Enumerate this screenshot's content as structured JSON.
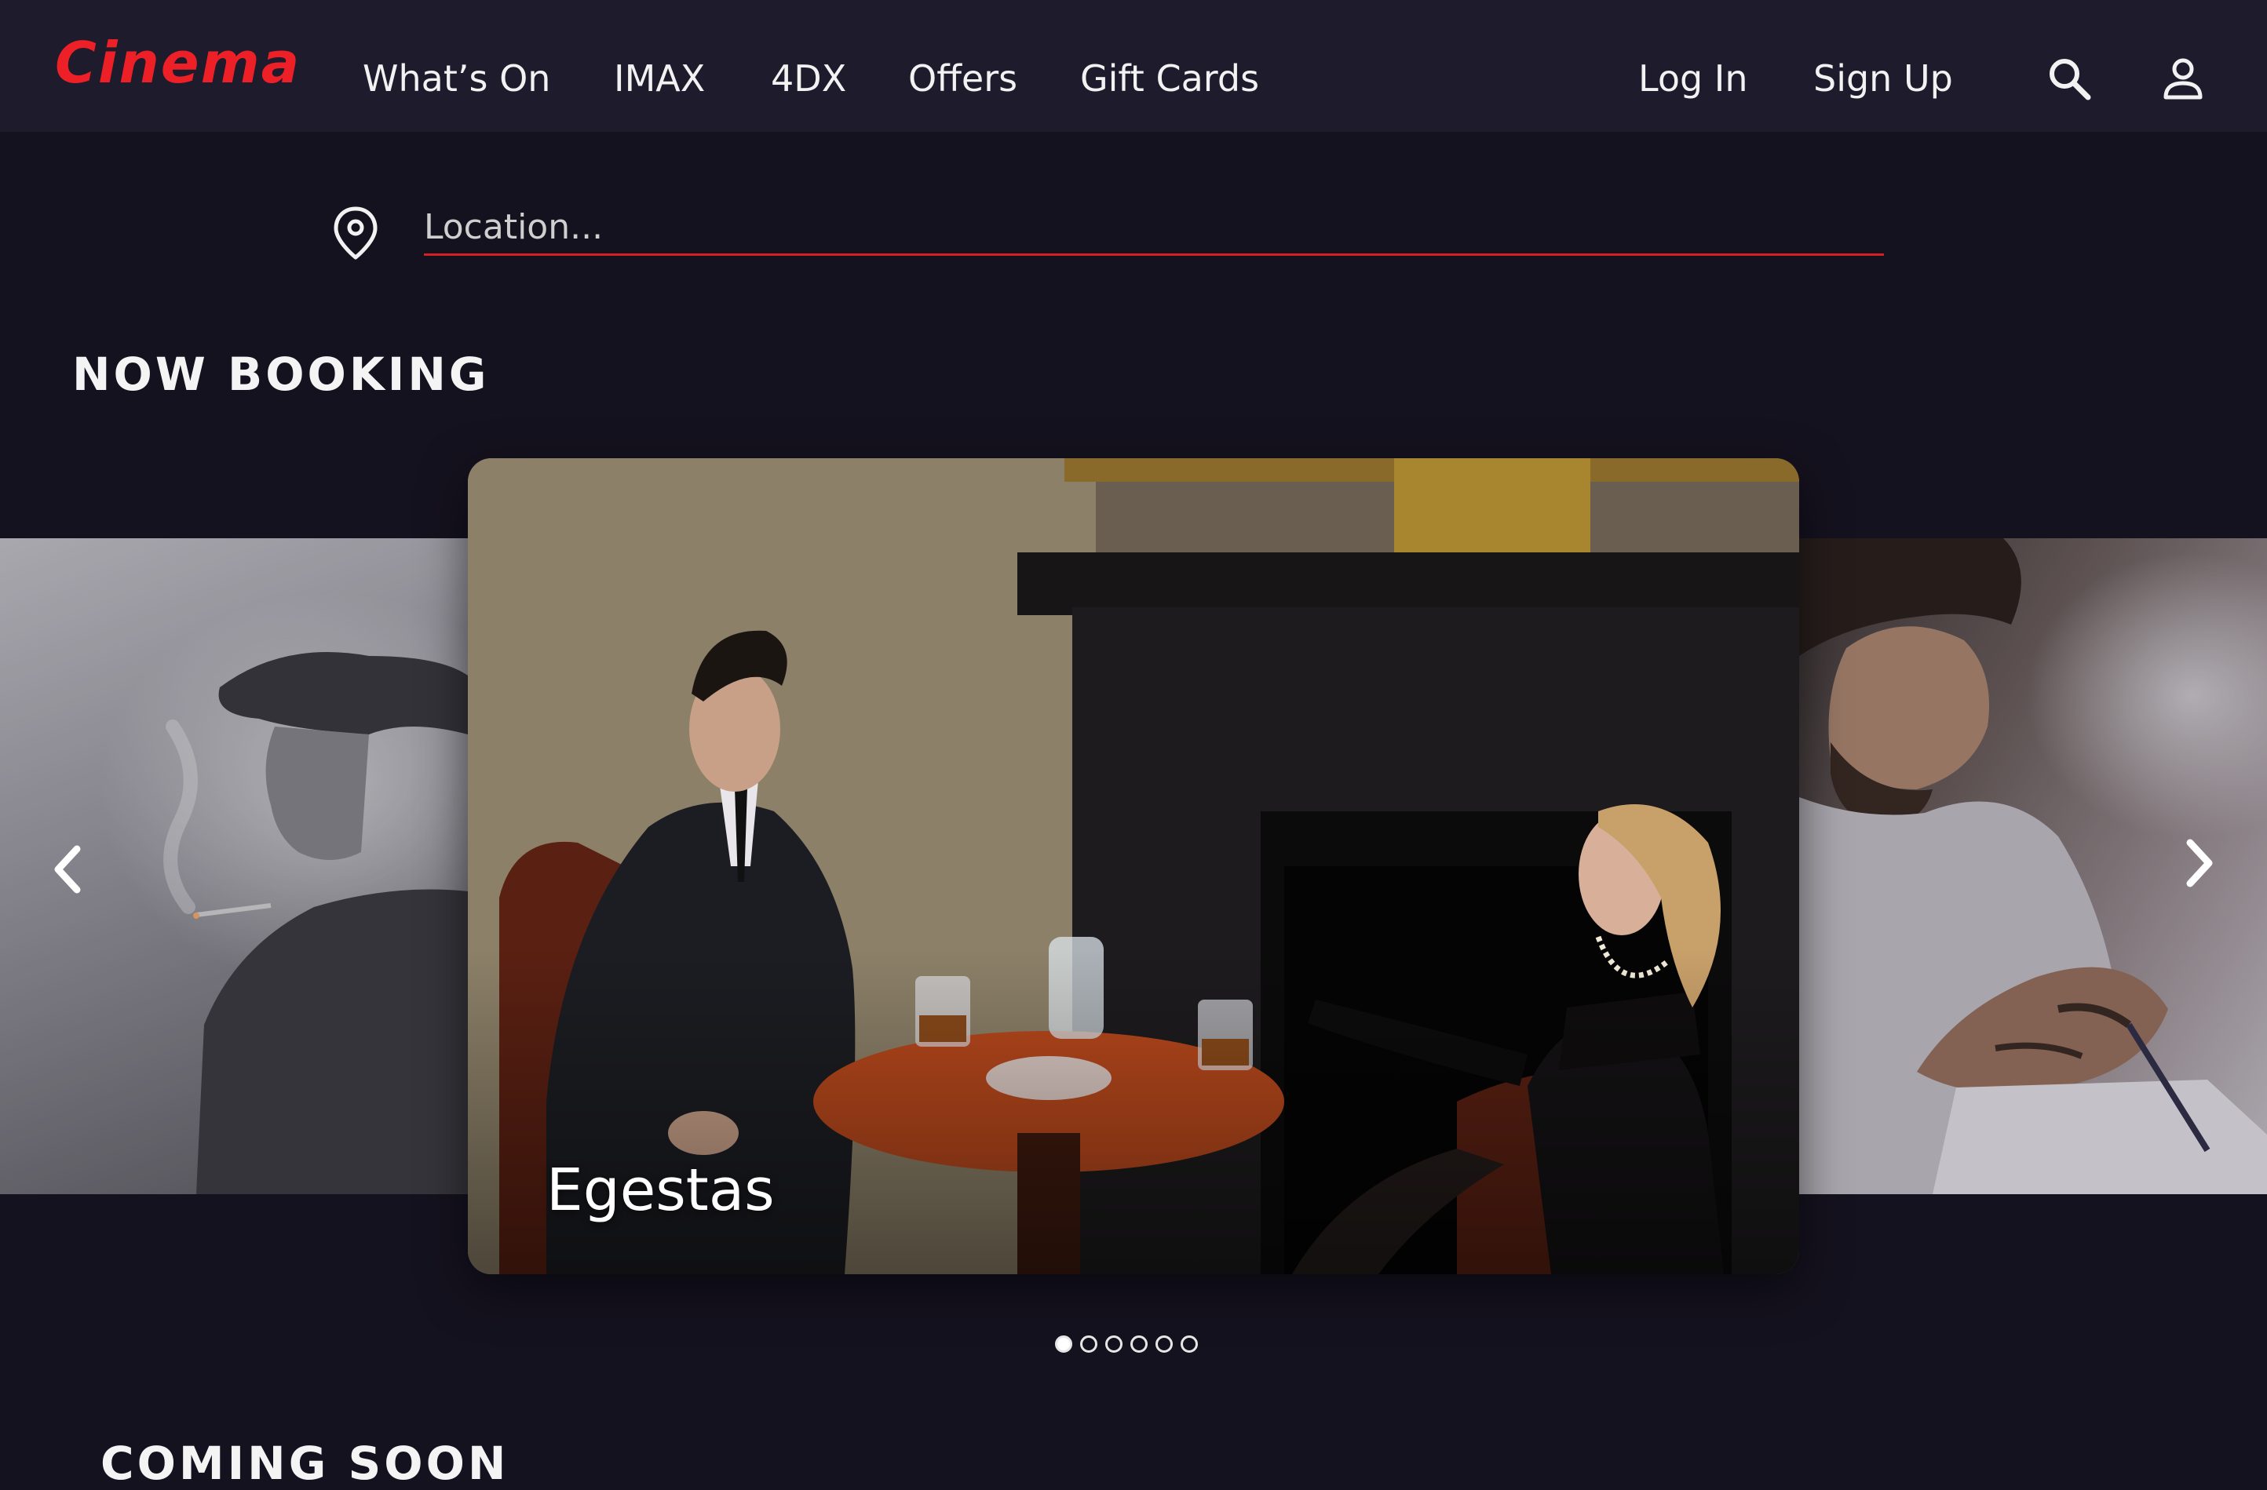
{
  "brand": {
    "logo_text": "Cinema",
    "accent": "#ec2026"
  },
  "nav": {
    "links": [
      "What’s On",
      "IMAX",
      "4DX",
      "Offers",
      "Gift Cards"
    ],
    "auth": {
      "login": "Log In",
      "signup": "Sign Up"
    },
    "icons": [
      "search-icon",
      "user-icon"
    ]
  },
  "location": {
    "placeholder": "Location..."
  },
  "now_booking": {
    "title": "NOW BOOKING",
    "active_slide": {
      "caption": "Egestas"
    },
    "dots_total": 6,
    "active_dot": 1
  },
  "coming_soon": {
    "title": "COMING SOON"
  }
}
